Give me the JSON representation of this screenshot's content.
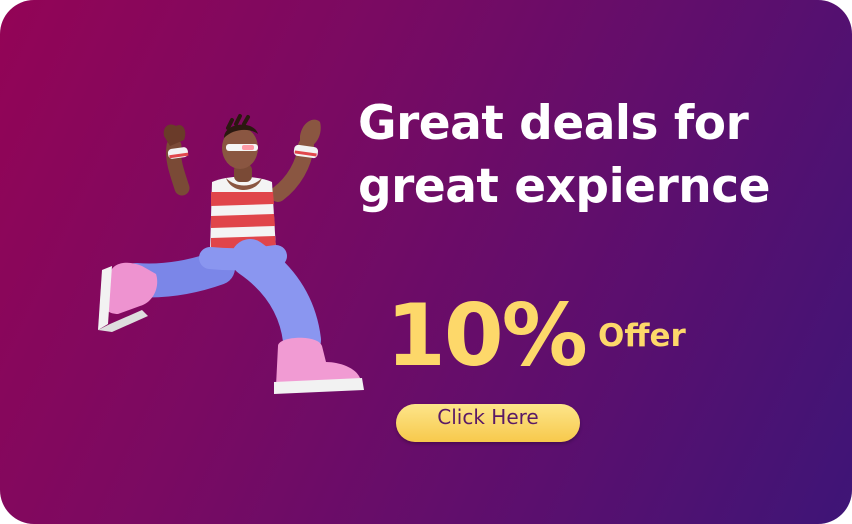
{
  "banner": {
    "headline_line1": "Great deals for",
    "headline_line2": "great expiernce",
    "discount": "10%",
    "offer_word": "Offer",
    "cta_label": "Click Here"
  },
  "colors": {
    "gradient_start": "#930456",
    "gradient_end": "#3e1577",
    "headline": "#ffffff",
    "accent_yellow": "#fdd86a",
    "button_text": "#5a1a66"
  },
  "illustration": {
    "subject": "running-character"
  }
}
